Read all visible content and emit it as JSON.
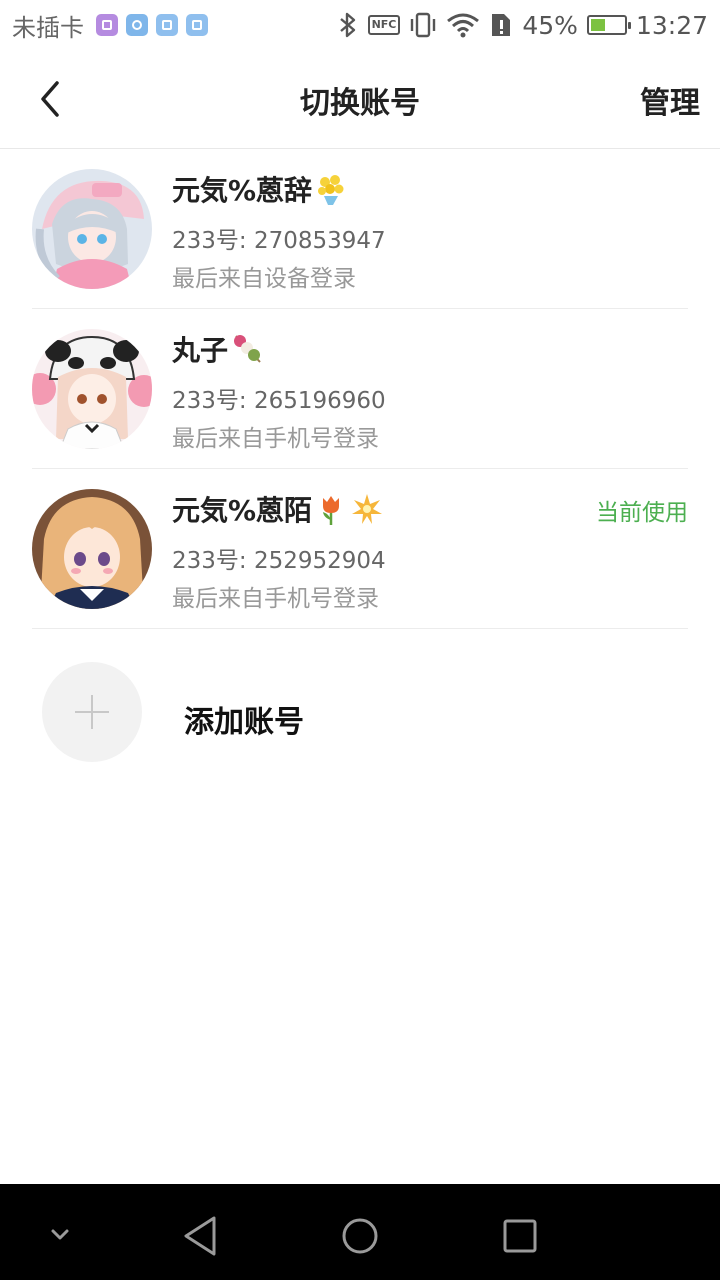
{
  "status_bar": {
    "carrier": "未插卡",
    "nfc_label": "NFC",
    "battery_percent": "45%",
    "battery_level": 0.45,
    "time": "13:27",
    "app_icon_colors": [
      "#b58be0",
      "#7fb6ea",
      "#8fbfee",
      "#8fbfee"
    ]
  },
  "header": {
    "title": "切换账号",
    "manage_label": "管理",
    "back_icon": "chevron-left-icon"
  },
  "accounts": [
    {
      "name": "元気%蒽辞",
      "emojis": [
        "bouquet-icon"
      ],
      "id_text": "233号: 270853947",
      "login_text": "最后来自设备登录",
      "current": ""
    },
    {
      "name": "丸子",
      "emojis": [
        "dango-icon"
      ],
      "id_text": "233号: 265196960",
      "login_text": "最后来自手机号登录",
      "current": ""
    },
    {
      "name": "元気%蒽陌",
      "emojis": [
        "tulip-icon",
        "sparkle-icon"
      ],
      "id_text": "233号: 252952904",
      "login_text": "最后来自手机号登录",
      "current": "当前使用"
    }
  ],
  "add_account": {
    "label": "添加账号",
    "icon": "plus-icon"
  },
  "nav_bar": {
    "icons": [
      "chevron-down-icon",
      "back-triangle-icon",
      "home-circle-icon",
      "recents-square-icon"
    ]
  },
  "colors": {
    "current_tag": "#4caf50",
    "divider": "#ececec",
    "nav_bg": "#000000"
  }
}
